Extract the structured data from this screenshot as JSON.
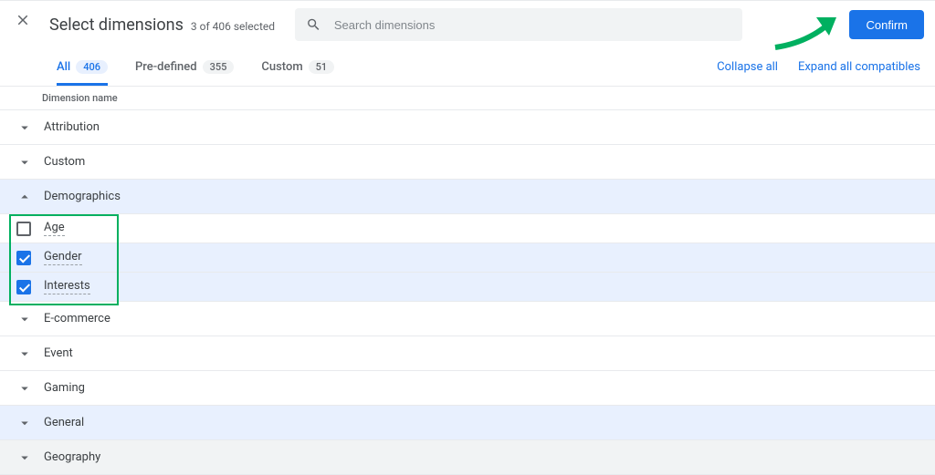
{
  "header": {
    "title": "Select dimensions",
    "subtitle": "3 of 406 selected",
    "search_placeholder": "Search dimensions",
    "confirm_label": "Confirm"
  },
  "tabs": {
    "all": {
      "label": "All",
      "count": "406"
    },
    "predefined": {
      "label": "Pre-defined",
      "count": "355"
    },
    "custom": {
      "label": "Custom",
      "count": "51"
    }
  },
  "links": {
    "collapse": "Collapse all",
    "expand": "Expand all compatibles"
  },
  "column_header": "Dimension name",
  "groups": {
    "attribution": "Attribution",
    "custom": "Custom",
    "demographics": "Demographics",
    "ecommerce": "E-commerce",
    "event": "Event",
    "gaming": "Gaming",
    "general": "General",
    "geography": "Geography"
  },
  "demographics_items": {
    "age": "Age",
    "gender": "Gender",
    "interests": "Interests"
  }
}
